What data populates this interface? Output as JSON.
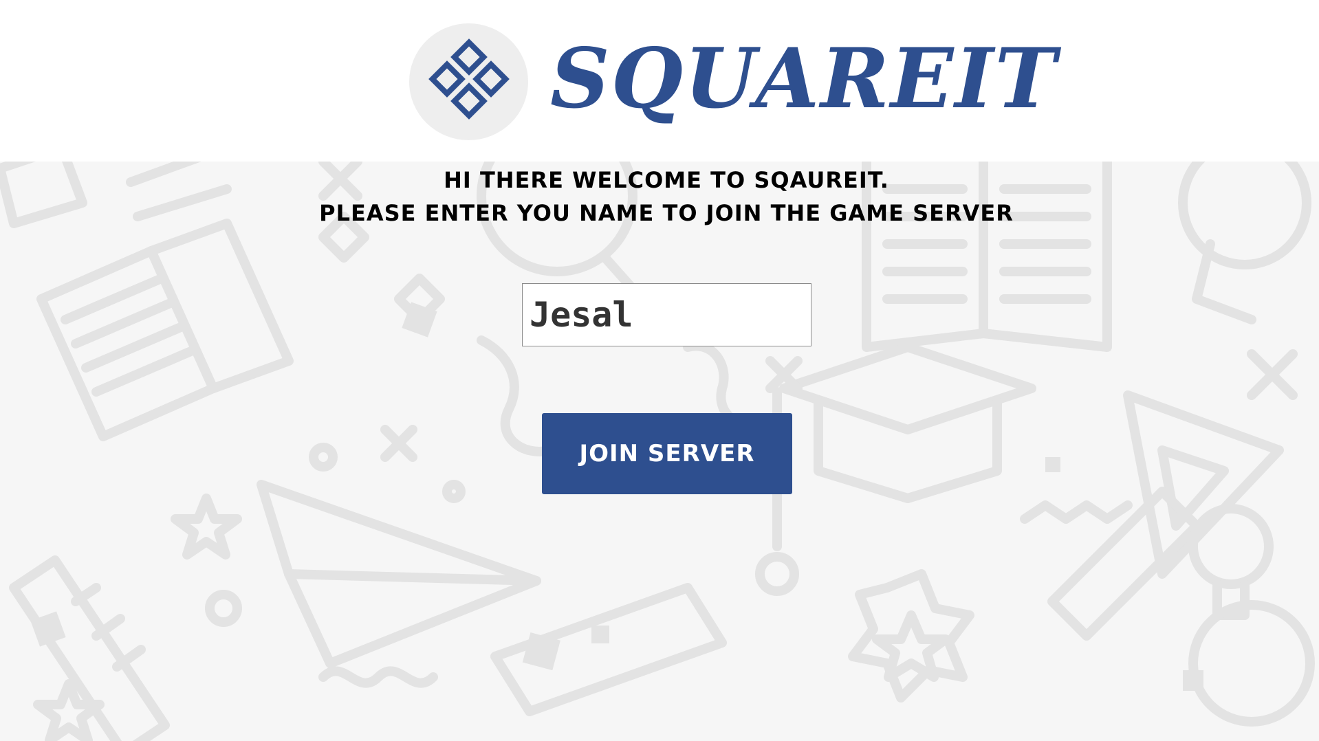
{
  "app": {
    "logo_icon": "four-diamonds-icon",
    "logo_text": "SQUAREIT"
  },
  "welcome": {
    "line1": "Hi there welcome to Sqaureit.",
    "line2": "Please enter you name to join the game Server"
  },
  "name_input": {
    "value": "Jesal"
  },
  "join_button": {
    "label": "Join Server"
  },
  "colors": {
    "brand": "#2e4f8f",
    "background": "#f6f6f6",
    "doodle": "#e3e3e3"
  }
}
